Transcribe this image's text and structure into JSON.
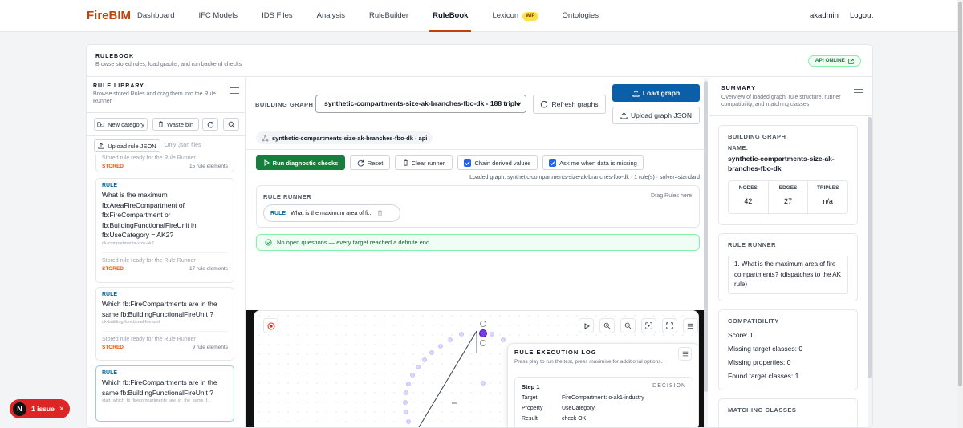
{
  "nav": {
    "brand": "FireBIM",
    "links": [
      "Dashboard",
      "IFC Models",
      "IDS Files",
      "Analysis",
      "RuleBuilder",
      "RuleBook",
      "Lexicon",
      "Ontologies"
    ],
    "active": "RuleBook",
    "wip_badge": "WIP",
    "user": "akadmin",
    "logout": "Logout"
  },
  "header": {
    "kicker": "RULEBOOK",
    "subtitle": "Browse stored rules, load graphs, and run backend checks",
    "api_status": "API ONLINE"
  },
  "library": {
    "kicker": "RULE LIBRARY",
    "subtitle": "Browse stored Rules and drag them into the Rule Runner",
    "new_category": "New category",
    "waste_bin": "Waste bin",
    "upload": "Upload rule JSON",
    "upload_hint": "Only .json files",
    "partial": {
      "ready": "Stored rule ready for the Rule Runner",
      "stored": "STORED",
      "count": "15 rule elements"
    },
    "rules": [
      {
        "tag": "RULE",
        "title": "What is the maximum fb:AreaFireCompartment of fb:FireCompartment or fb:BuildingFunctionalFireUnit in fb:UseCategory = AK2?",
        "slug": "dk-compartments-size-ak2",
        "ready": "Stored rule ready for the Rule Runner",
        "stored": "STORED",
        "count": "17 rule elements"
      },
      {
        "tag": "RULE",
        "title": "Which fb:FireCompartments are in the same fb:BuildingFunctionalFireUnit ?",
        "slug": "dk-building-functional-fire-unit",
        "ready": "Stored rule ready for the Rule Runner",
        "stored": "STORED",
        "count": "9 rule elements"
      },
      {
        "tag": "RULE",
        "title": "Which fb:FireCompartments are in the same fb:BuildingFunctionalFireUnit ?",
        "slug": "start_which_fb_firecompartments_are_in_the_same_f..."
      }
    ]
  },
  "center": {
    "graph_label": "BUILDING GRAPH",
    "graph_select": "synthetic-compartments-size-ak-branches-fbo-dk - 188 triple",
    "refresh": "Refresh graphs",
    "load": "Load graph",
    "upload": "Upload graph JSON",
    "graph_chip": "synthetic-compartments-size-ak-branches-fbo-dk - api",
    "run": "Run diagnostic checks",
    "reset": "Reset",
    "clear": "Clear runner",
    "chain": "Chain derived values",
    "ask": "Ask me when data is missing",
    "loaded_info": "Loaded graph: synthetic-compartments-size-ak-branches-fbo-dk · 1 rule(s) · solver=standard",
    "runner_title": "RULE RUNNER",
    "drag_hint": "Drag Rules here",
    "runner_rule_tag": "RULE",
    "runner_rule_text": "What is the maximum area of fi...",
    "no_questions": "No open questions — every target reached a definite end."
  },
  "log": {
    "title": "RULE EXECUTION LOG",
    "subtitle": "Press play to run the test, press maximise for additional options.",
    "step": "Step 1",
    "decision": "DECISION",
    "rows": [
      {
        "k": "Target",
        "v": "FireCompartment: o-ak1-industry"
      },
      {
        "k": "Property",
        "v": "UseCategory"
      },
      {
        "k": "Result",
        "v": "check OK"
      }
    ]
  },
  "summary": {
    "kicker": "SUMMARY",
    "subtitle": "Overview of loaded graph, rule structure, runner compatibility, and matching classes",
    "bg_label": "BUILDING GRAPH",
    "name_label": "NAME:",
    "name": "synthetic-compartments-size-ak-branches-fbo-dk",
    "stats": [
      {
        "label": "NODES",
        "value": "42"
      },
      {
        "label": "EDGES",
        "value": "27"
      },
      {
        "label": "TRIPLES",
        "value": "n/a"
      }
    ],
    "runner_label": "RULE RUNNER",
    "runner_item": "1.  What is the maximum area of fire compartments? (dispatches to the AK rule)",
    "compat_label": "COMPATIBILITY",
    "compat": [
      "Score: 1",
      "Missing target classes: 0",
      "Missing properties: 0",
      "Found target classes: 1"
    ],
    "matching_label": "MATCHING CLASSES"
  },
  "issue": {
    "badge": "N",
    "text": "1 issue",
    "close": "×"
  },
  "colors": {
    "brand": "#c2410c",
    "primary": "#0b5ea8",
    "run": "#15803d",
    "issue": "#dc2626"
  }
}
